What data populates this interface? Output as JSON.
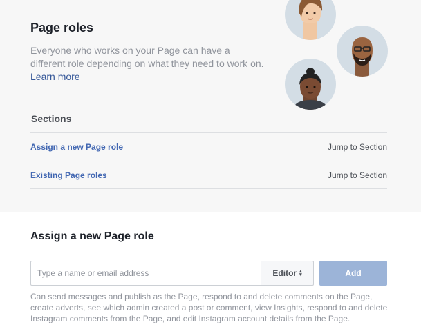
{
  "header": {
    "title": "Page roles",
    "description": "Everyone who works on your Page can have a different role depending on what they need to work on.",
    "learn_more": "Learn more"
  },
  "sections": {
    "label": "Sections",
    "items": [
      {
        "label": "Assign a new Page role",
        "jump": "Jump to Section"
      },
      {
        "label": "Existing Page roles",
        "jump": "Jump to Section"
      }
    ]
  },
  "assign": {
    "title": "Assign a new Page role",
    "input_placeholder": "Type a name or email address",
    "role_selected": "Editor",
    "add_label": "Add",
    "help_text": "Can send messages and publish as the Page, respond to and delete comments on the Page, create adverts, see which admin created a post or comment, view Insights, respond to and delete Instagram comments from the Page, and edit Instagram account details from the Page."
  },
  "icons": [
    "person-illustration-1",
    "person-illustration-2",
    "person-illustration-3",
    "caret-updown-icon"
  ],
  "colors": {
    "link": "#365899",
    "accent": "#4267b2",
    "add_button_disabled": "#9cb4d8",
    "top_background": "#f7f7f7"
  }
}
